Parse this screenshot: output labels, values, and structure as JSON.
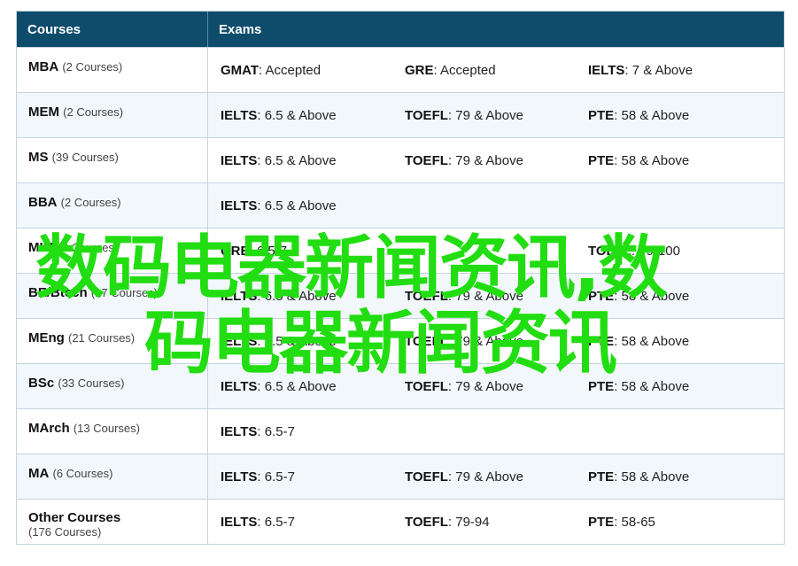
{
  "table": {
    "headers": {
      "courses": "Courses",
      "exams": "Exams"
    },
    "rows": [
      {
        "name": "MBA",
        "count": "(2 Courses)",
        "layout": "inline",
        "exams": [
          {
            "name": "GMAT",
            "value": ": Accepted"
          },
          {
            "name": "GRE",
            "value": ": Accepted"
          },
          {
            "name": "IELTS",
            "value": ": 7 & Above"
          }
        ]
      },
      {
        "name": "MEM",
        "count": "(2 Courses)",
        "layout": "inline",
        "exams": [
          {
            "name": "IELTS",
            "value": ": 6.5 & Above"
          },
          {
            "name": "TOEFL",
            "value": ": 79 & Above"
          },
          {
            "name": "PTE",
            "value": ": 58 & Above"
          }
        ]
      },
      {
        "name": "MS",
        "count": "(39 Courses)",
        "layout": "inline",
        "exams": [
          {
            "name": "IELTS",
            "value": ": 6.5 & Above"
          },
          {
            "name": "TOEFL",
            "value": ": 79 & Above"
          },
          {
            "name": "PTE",
            "value": ": 58 & Above"
          }
        ]
      },
      {
        "name": "BBA",
        "count": "(2 Courses)",
        "layout": "inline",
        "exams": [
          {
            "name": "IELTS",
            "value": ": 6.5 & Above"
          },
          {
            "name": "",
            "value": ""
          },
          {
            "name": "",
            "value": ""
          }
        ]
      },
      {
        "name": "MIM",
        "count": "(2 Courses)",
        "layout": "inline",
        "exams": [
          {
            "name": "GRE",
            "value": ": 6.5-7"
          },
          {
            "name": "",
            "value": ""
          },
          {
            "name": "TOEFL",
            "value": ": 79-100"
          }
        ]
      },
      {
        "name": "BE/Btech",
        "count": "(17 Courses)",
        "layout": "inline",
        "exams": [
          {
            "name": "IELTS",
            "value": ": 6.5 & Above"
          },
          {
            "name": "TOEFL",
            "value": ": 79 & Above"
          },
          {
            "name": "PTE",
            "value": ": 58 & Above"
          }
        ]
      },
      {
        "name": "MEng",
        "count": "(21 Courses)",
        "layout": "inline",
        "exams": [
          {
            "name": "IELTS",
            "value": ": 6.5 & Above"
          },
          {
            "name": "TOEFL",
            "value": ": 79 & Above"
          },
          {
            "name": "PTE",
            "value": ": 58 & Above"
          }
        ]
      },
      {
        "name": "BSc",
        "count": "(33 Courses)",
        "layout": "inline",
        "exams": [
          {
            "name": "IELTS",
            "value": ": 6.5 & Above"
          },
          {
            "name": "TOEFL",
            "value": ": 79 & Above"
          },
          {
            "name": "PTE",
            "value": ": 58 & Above"
          }
        ]
      },
      {
        "name": "MArch",
        "count": "(13 Courses)",
        "layout": "inline",
        "exams": [
          {
            "name": "IELTS",
            "value": ": 6.5-7"
          },
          {
            "name": "",
            "value": ""
          },
          {
            "name": "",
            "value": ""
          }
        ]
      },
      {
        "name": "MA",
        "count": "(6 Courses)",
        "layout": "inline",
        "exams": [
          {
            "name": "IELTS",
            "value": ": 6.5-7"
          },
          {
            "name": "TOEFL",
            "value": ": 79 & Above"
          },
          {
            "name": "PTE",
            "value": ": 58 & Above"
          }
        ]
      },
      {
        "name": "Other Courses",
        "count": "(176 Courses)",
        "layout": "stacked",
        "exams": [
          {
            "name": "IELTS",
            "value": ": 6.5-7"
          },
          {
            "name": "TOEFL",
            "value": ": 79-94"
          },
          {
            "name": "PTE",
            "value": ": 58-65"
          }
        ]
      }
    ]
  },
  "watermark": {
    "line1": "数码电器新闻资讯,数",
    "line2": "码电器新闻资讯",
    "color": "#22dd11"
  }
}
